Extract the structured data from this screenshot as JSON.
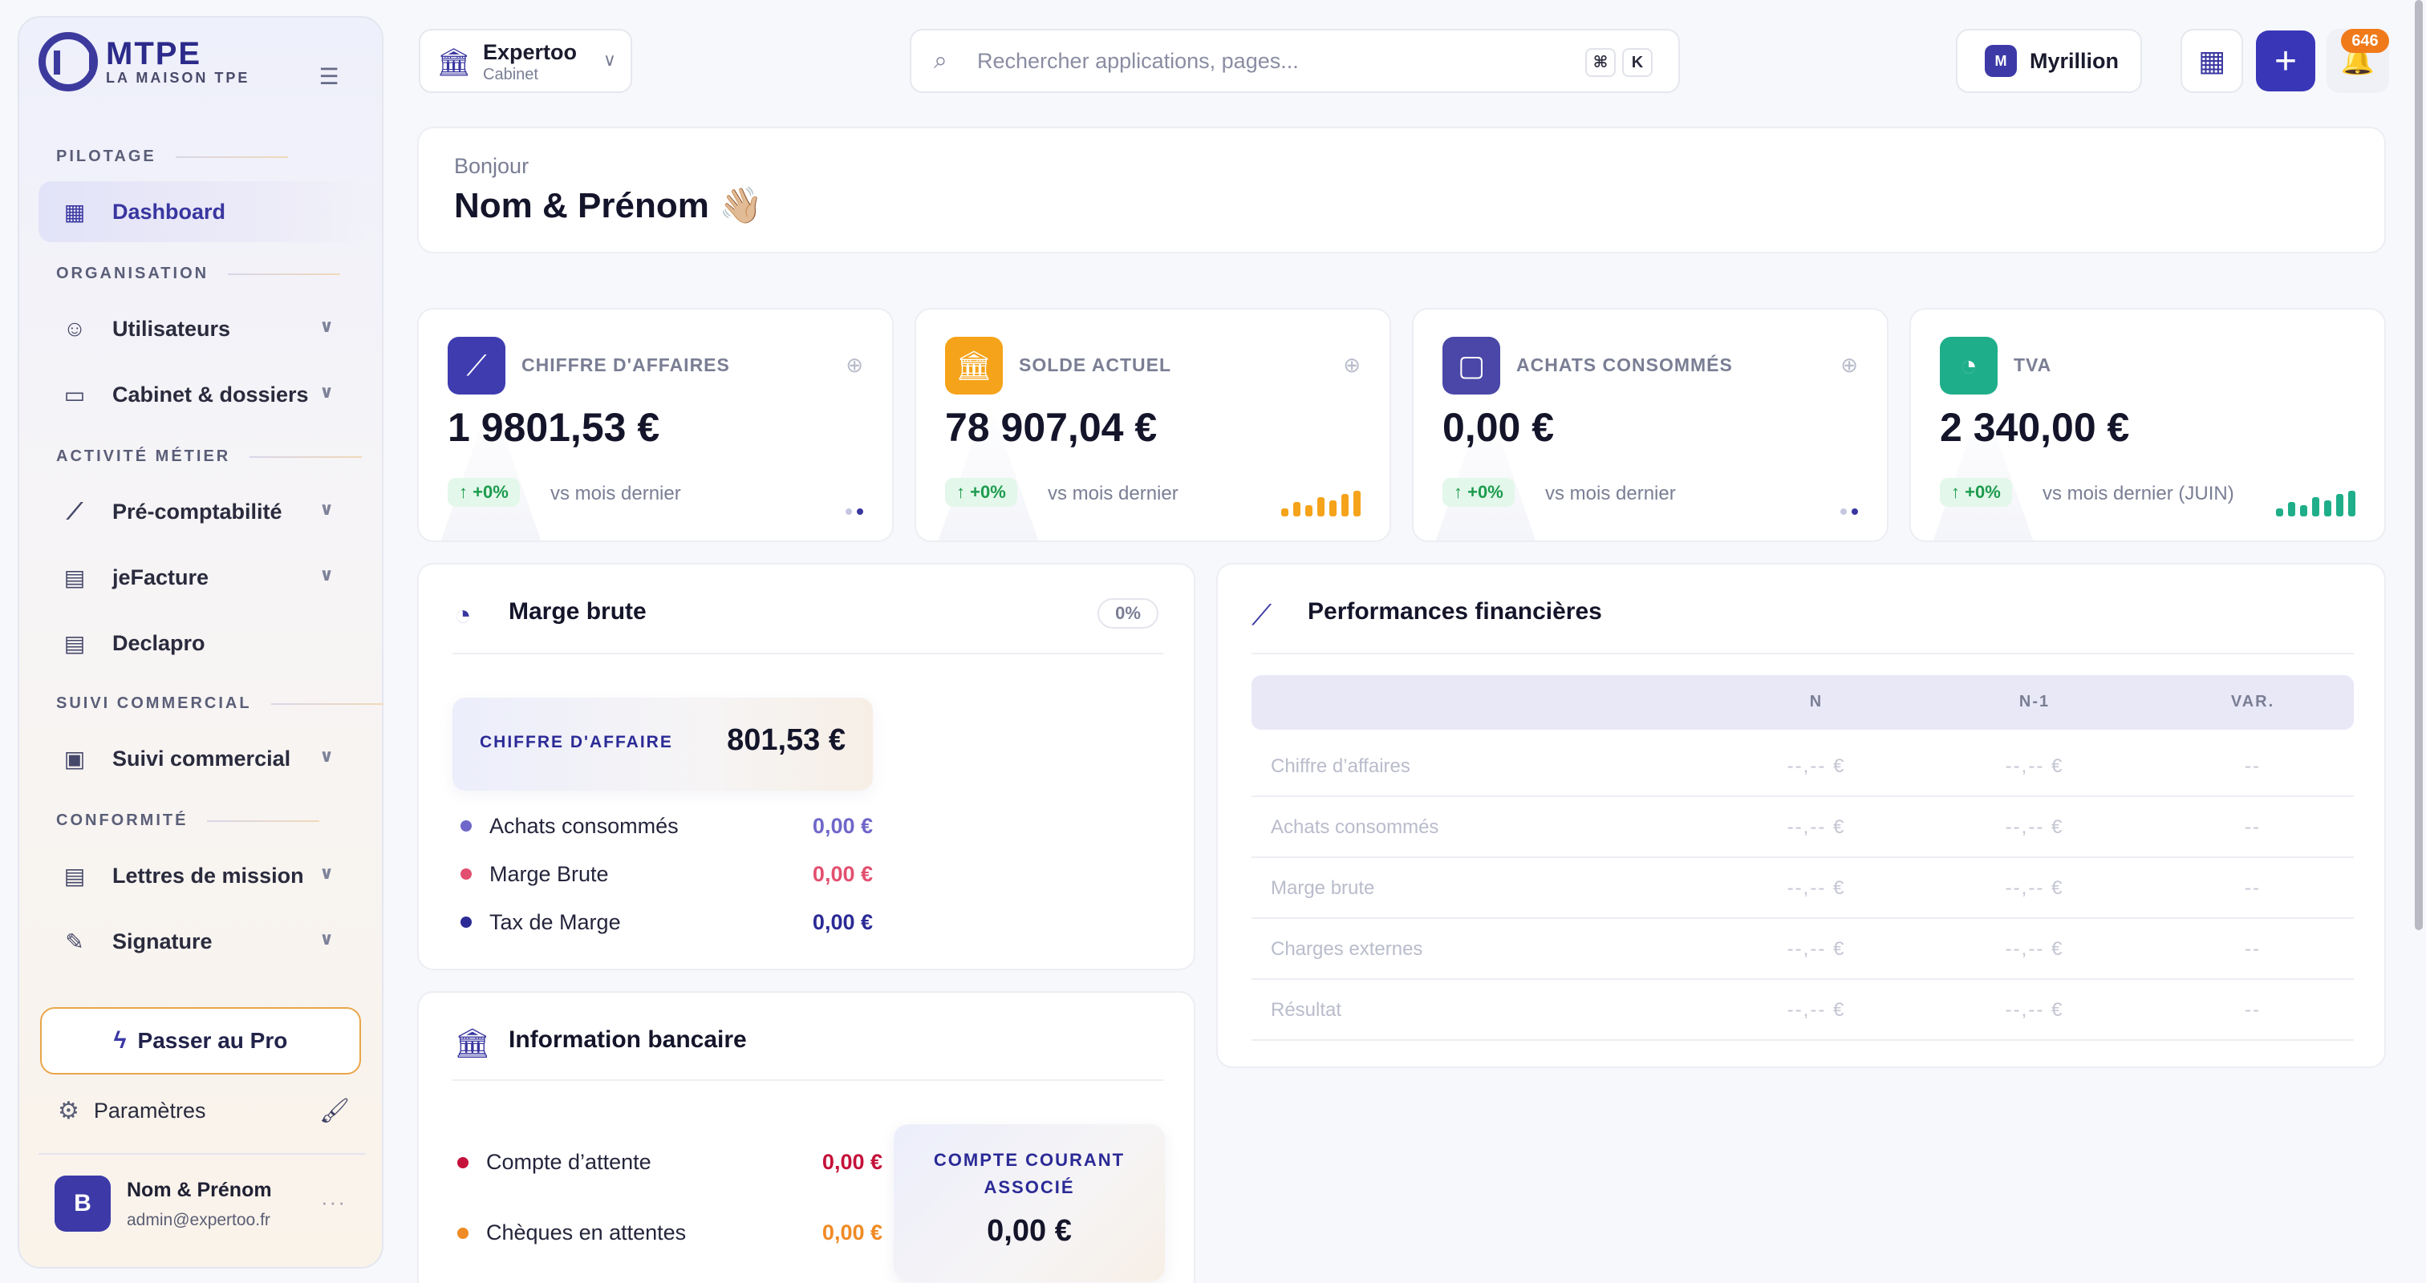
{
  "brand": {
    "name": "MTPE",
    "tagline": "LA MAISON TPE"
  },
  "sidebar": {
    "sections": {
      "pilotage": "PILOTAGE",
      "organisation": "ORGANISATION",
      "activite": "ACTIVITÉ MÉTIER",
      "suivi": "SUIVI COMMERCIAL",
      "conformite": "CONFORMITÉ"
    },
    "items": {
      "dashboard": "Dashboard",
      "utilisateurs": "Utilisateurs",
      "cabinet": "Cabinet & dossiers",
      "precompta": "Pré-comptabilité",
      "jefacture": "jeFacture",
      "declapro": "Declapro",
      "suivi_commercial": "Suivi commercial",
      "lettres": "Lettres de mission",
      "signature": "Signature"
    },
    "pro_button": "Passer au Pro",
    "settings": "Paramètres",
    "user": {
      "initial": "B",
      "name": "Nom & Prénom",
      "email": "admin@expertoo.fr"
    }
  },
  "topbar": {
    "org_name": "Expertoo",
    "org_sub": "Cabinet",
    "search_placeholder": "Rechercher applications, pages...",
    "kbd_cmd": "⌘",
    "kbd_k": "K",
    "myrillion": "Myrillion",
    "notif_count": "646"
  },
  "greeting": {
    "hello": "Bonjour",
    "name": "Nom & Prénom 👋🏼"
  },
  "stats": [
    {
      "label": "CHIFFRE D'AFFAIRES",
      "value": "1 9801,53 €",
      "trend": "↑ +0%",
      "vs": "vs mois dernier",
      "color": "#3f3cb0"
    },
    {
      "label": "SOLDE ACTUEL",
      "value": "78 907,04 €",
      "trend": "↑ +0%",
      "vs": "vs mois dernier",
      "color": "#f5a31a"
    },
    {
      "label": "ACHATS CONSOMMÉS",
      "value": "0,00 €",
      "trend": "↑ +0%",
      "vs": "vs mois dernier",
      "color": "#4a47a8"
    },
    {
      "label": "TVA",
      "value": "2 340,00 €",
      "trend": "↑ +0%",
      "vs": "vs mois dernier (JUIN)",
      "color": "#1fae8a"
    }
  ],
  "marge": {
    "title": "Marge brute",
    "pct": "0%",
    "ca_label": "CHIFFRE D'AFFAIRE",
    "ca_value": "801,53 €",
    "rows": [
      {
        "label": "Achats consommés",
        "value": "0,00 €",
        "color": "#6f67c9"
      },
      {
        "label": "Marge Brute",
        "value": "0,00 €",
        "color": "#e2506f"
      },
      {
        "label": "Tax de Marge",
        "value": "0,00 €",
        "color": "#2b2a96"
      }
    ]
  },
  "bank": {
    "title": "Information bancaire",
    "rows": [
      {
        "label": "Compte d’attente",
        "value": "0,00 €",
        "color": "#c4123a"
      },
      {
        "label": "Chèques en attentes",
        "value": "0,00 €",
        "color": "#f08a24"
      }
    ],
    "cca_label": "COMPTE COURANT ASSOCIÉ",
    "cca_value": "0,00 €"
  },
  "perf": {
    "title": "Performances financières",
    "columns": [
      "N",
      "N-1",
      "VAR."
    ],
    "rows": [
      {
        "label": "Chiffre d’affaires",
        "n": "--,-- €",
        "n1": "--,-- €",
        "var": "--"
      },
      {
        "label": "Achats consommés",
        "n": "--,-- €",
        "n1": "--,-- €",
        "var": "--"
      },
      {
        "label": "Marge brute",
        "n": "--,-- €",
        "n1": "--,-- €",
        "var": "--"
      },
      {
        "label": "Charges externes",
        "n": "--,-- €",
        "n1": "--,-- €",
        "var": "--"
      },
      {
        "label": "Résultat",
        "n": "--,-- €",
        "n1": "--,-- €",
        "var": "--"
      }
    ]
  }
}
